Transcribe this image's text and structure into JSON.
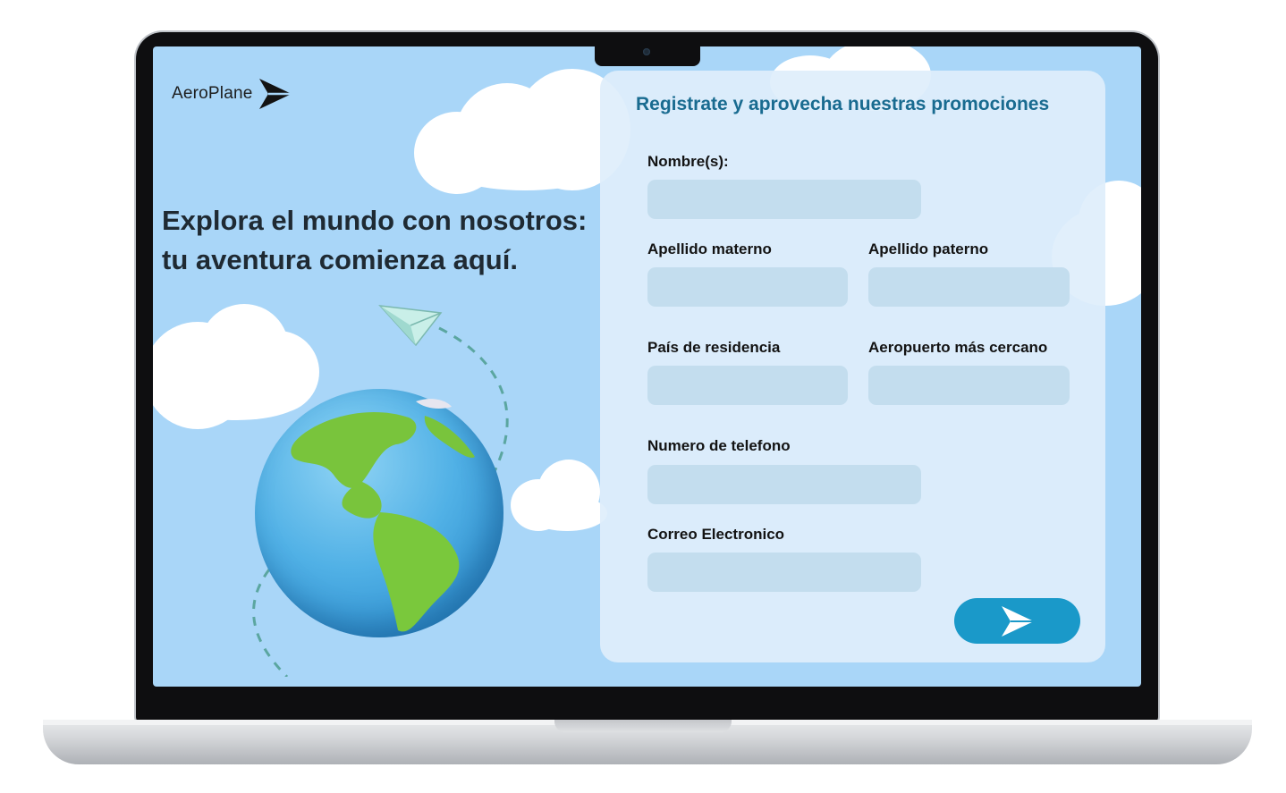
{
  "brand": {
    "name": "AeroPlane",
    "logo_icon": "paper-plane-arrow-icon"
  },
  "hero": {
    "line1": "Explora el mundo con nosotros:",
    "line2": "tu aventura comienza aquí."
  },
  "form": {
    "title": "Registrate y aprovecha nuestras promociones",
    "fields": {
      "nombre": {
        "label": "Nombre(s):",
        "value": ""
      },
      "apellido_materno": {
        "label": "Apellido materno",
        "value": ""
      },
      "apellido_paterno": {
        "label": "Apellido paterno",
        "value": ""
      },
      "pais": {
        "label": "País de residencia",
        "value": ""
      },
      "aeropuerto": {
        "label": "Aeropuerto más cercano",
        "value": ""
      },
      "telefono": {
        "label": "Numero de telefono",
        "value": ""
      },
      "correo": {
        "label": "Correo Electronico",
        "value": ""
      }
    },
    "submit_icon": "send-icon"
  },
  "colors": {
    "screen_bg": "#a9d6f8",
    "panel_bg": "#dfeefb",
    "title": "#196b90",
    "input_bg": "#c3ddee",
    "button": "#1a99c9"
  }
}
